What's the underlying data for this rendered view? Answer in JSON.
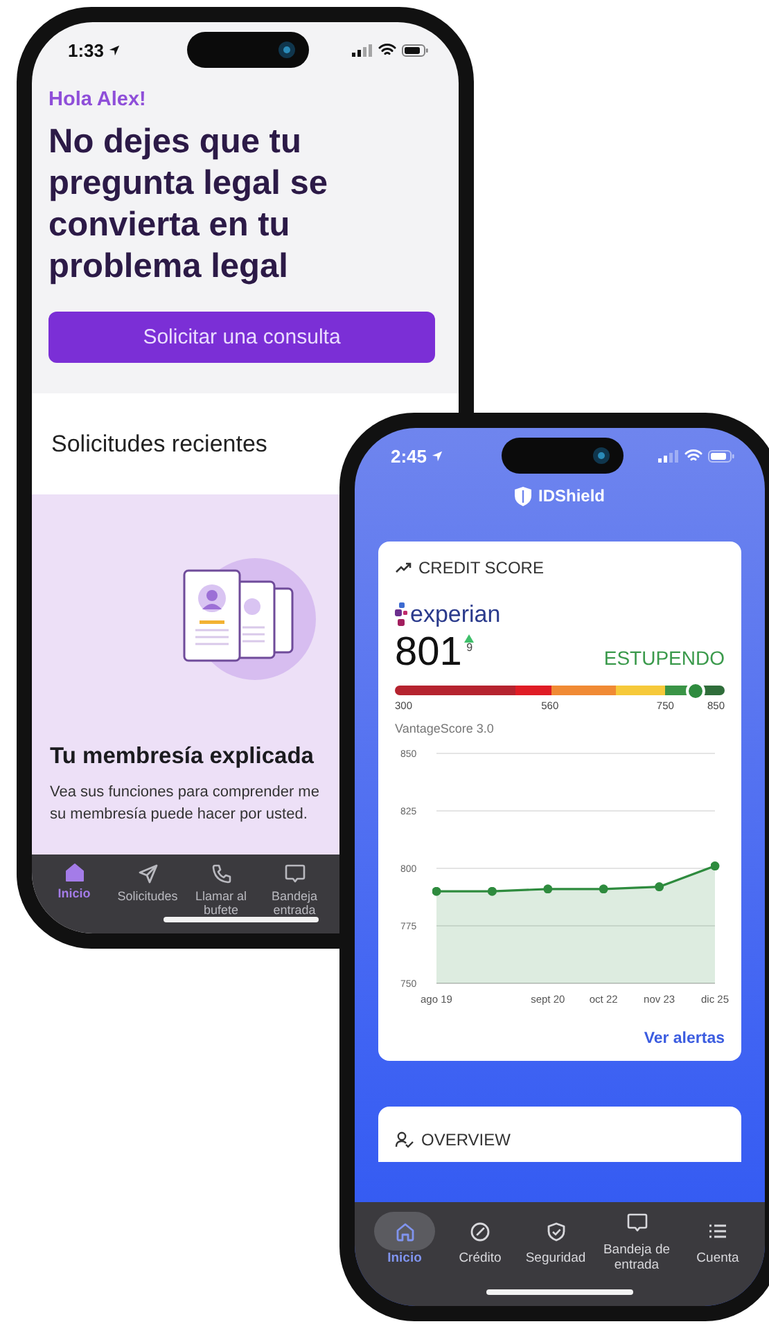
{
  "legal_app": {
    "status_bar": {
      "time": "1:33"
    },
    "greeting": "Hola Alex!",
    "headline": "No dejes que tu pregunta legal se convierta en tu problema legal",
    "request_button": "Solicitar una consulta",
    "recent_title": "Solicitudes recientes",
    "membership": {
      "title": "Tu membresía explicada",
      "description_lines": [
        "Vea sus funciones para comprender me",
        "su membresía puede hacer por usted."
      ]
    },
    "tabs": [
      {
        "label": "Inicio",
        "selected": true
      },
      {
        "label": "Solicitudes",
        "selected": false
      },
      {
        "label": "Llamar al bufete",
        "selected": false
      },
      {
        "label": "Bandeja entrada",
        "selected": false
      }
    ]
  },
  "credit_app": {
    "status_bar": {
      "time": "2:45"
    },
    "brand": "IDShield",
    "credit_score": {
      "title": "CREDIT SCORE",
      "bureau": "experian",
      "score": "801",
      "change": "9",
      "rating": "ESTUPENDO",
      "meter": {
        "level": 0.91,
        "labels": [
          "300",
          "560",
          "750",
          "850"
        ]
      },
      "model": "VantageScore 3.0",
      "chart_data": {
        "type": "area",
        "categories": [
          "ago 19",
          null,
          "sept 20",
          "oct 22",
          "nov 23",
          "dic 25"
        ],
        "series": [
          {
            "color": "#2e8b3e",
            "values": [
              790,
              790,
              791,
              791,
              792,
              801
            ]
          }
        ],
        "ylim": [
          750,
          850
        ],
        "yticks": [
          750,
          775,
          800,
          825,
          850
        ],
        "grid": true
      },
      "link": "Ver alertas"
    },
    "overview_title": "OVERVIEW",
    "tabs": [
      {
        "label": "Inicio",
        "selected": true
      },
      {
        "label": "Crédito",
        "selected": false
      },
      {
        "label": "Seguridad",
        "selected": false
      },
      {
        "label": "Bandeja de entrada",
        "selected": false
      },
      {
        "label": "Cuenta",
        "selected": false
      }
    ]
  }
}
